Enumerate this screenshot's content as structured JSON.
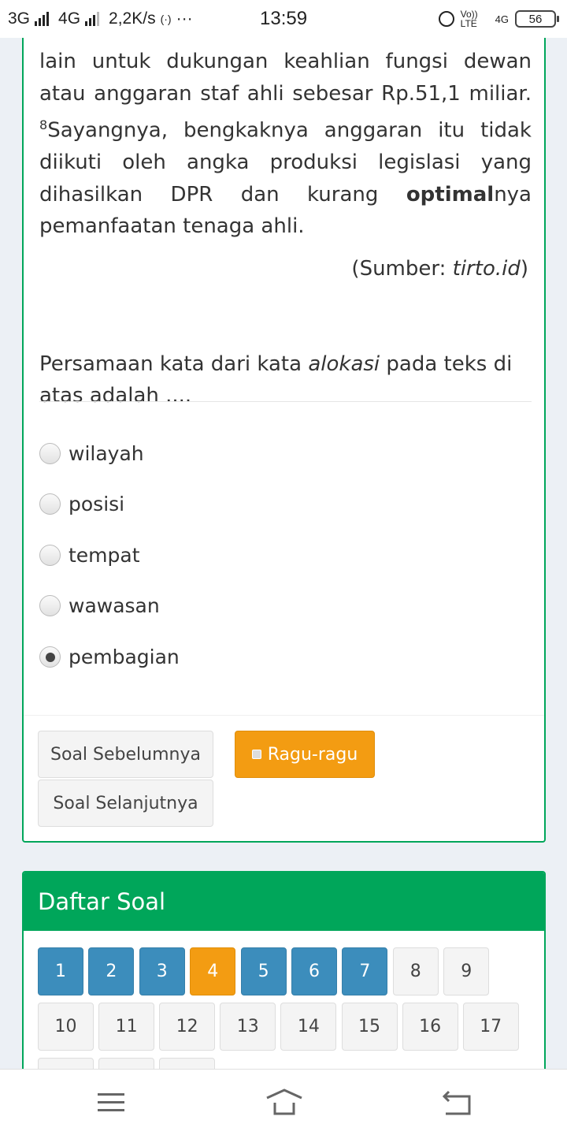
{
  "status_bar": {
    "network_left": "3G",
    "network_mid": "4G",
    "speed": "2,2K/s",
    "dots": "···",
    "time": "13:59",
    "volte": "Vo)) LTE",
    "net_right": "4G",
    "battery": "56"
  },
  "passage": {
    "line_text_1": "lain untuk dukungan keahlian fungsi dewan atau anggaran staf ahli sebesar Rp.51,1 miliar. ",
    "sup": "8",
    "line_text_2": "Sayangnya, bengkaknya anggaran itu tidak diikuti oleh angka produksi legislasi yang dihasilkan DPR dan kurang ",
    "bold": "optimal",
    "line_text_3": "nya pemanfaatan tenaga ahli.",
    "source_prefix": "(Sumber: ",
    "source_name": "tirto.id",
    "source_suffix": ")"
  },
  "question": {
    "prefix": "Persamaan kata dari kata ",
    "keyword": "alokasi",
    "suffix": " pada teks di atas adalah ...."
  },
  "options": [
    {
      "label": "wilayah",
      "selected": false
    },
    {
      "label": "posisi",
      "selected": false
    },
    {
      "label": "tempat",
      "selected": false
    },
    {
      "label": "wawasan",
      "selected": false
    },
    {
      "label": "pembagian",
      "selected": true
    }
  ],
  "buttons": {
    "prev": "Soal Sebelumnya",
    "doubt": "Ragu-ragu",
    "next": "Soal Selanjutnya"
  },
  "daftar": {
    "title": "Daftar Soal",
    "numbers": [
      {
        "n": "1",
        "state": "answered"
      },
      {
        "n": "2",
        "state": "answered"
      },
      {
        "n": "3",
        "state": "answered"
      },
      {
        "n": "4",
        "state": "doubt"
      },
      {
        "n": "5",
        "state": "answered"
      },
      {
        "n": "6",
        "state": "answered"
      },
      {
        "n": "7",
        "state": "answered"
      },
      {
        "n": "8",
        "state": "empty"
      },
      {
        "n": "9",
        "state": "empty"
      },
      {
        "n": "10",
        "state": "empty"
      },
      {
        "n": "11",
        "state": "empty"
      },
      {
        "n": "12",
        "state": "empty"
      },
      {
        "n": "13",
        "state": "empty"
      },
      {
        "n": "14",
        "state": "empty"
      },
      {
        "n": "15",
        "state": "empty"
      },
      {
        "n": "16",
        "state": "empty"
      },
      {
        "n": "17",
        "state": "empty"
      }
    ]
  },
  "colors": {
    "green": "#00a65a",
    "blue": "#3c8dbc",
    "orange": "#f39c12"
  },
  "nav": {
    "menu_icon": "menu-icon",
    "home_icon": "home-icon",
    "back_icon": "back-icon"
  }
}
